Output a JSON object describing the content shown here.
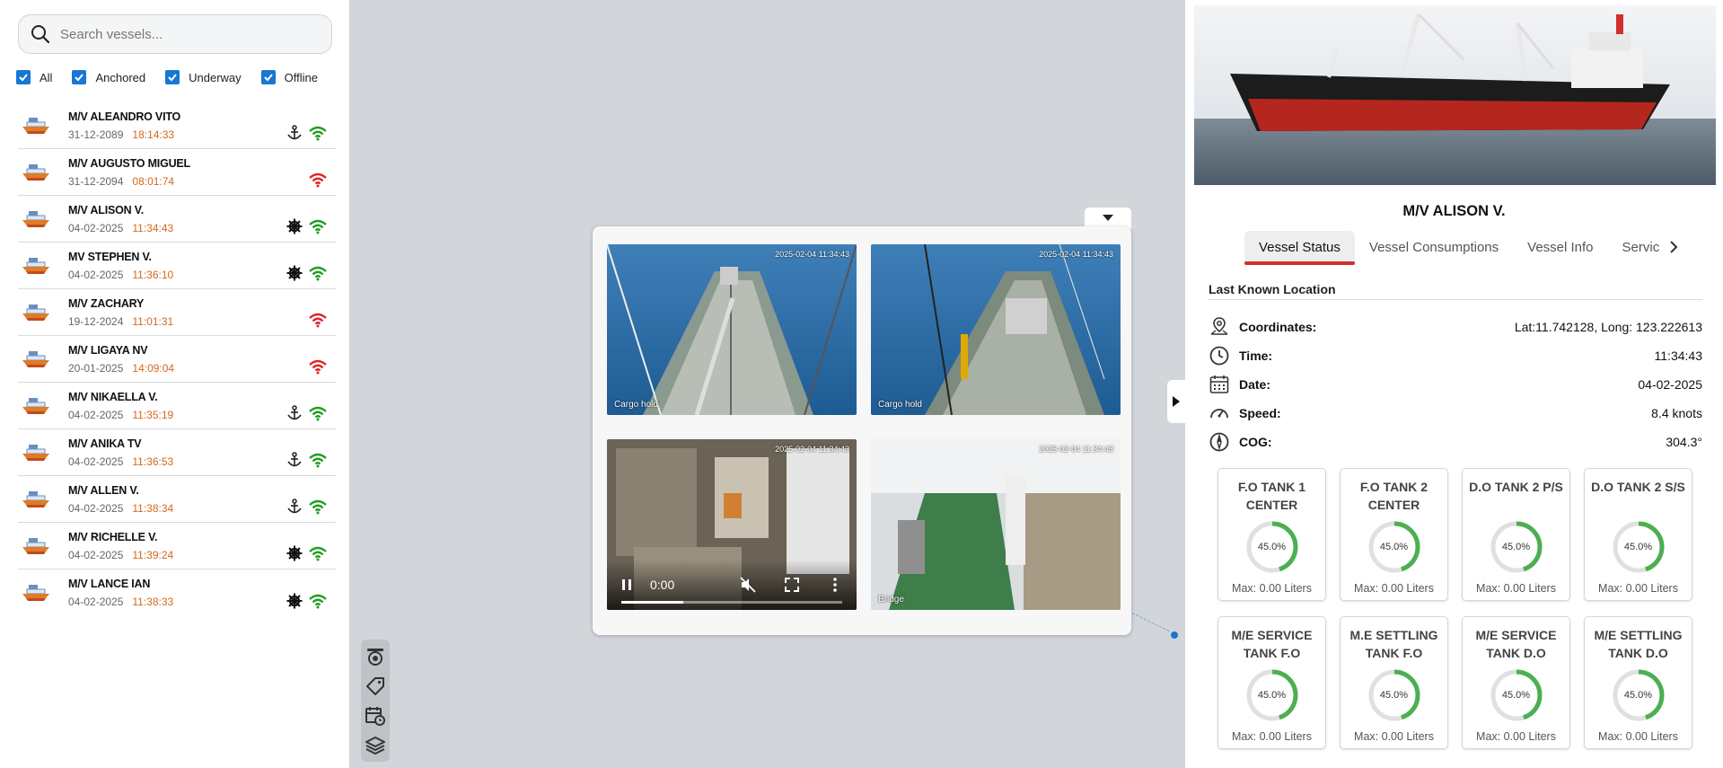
{
  "search": {
    "placeholder": "Search vessels..."
  },
  "filters": [
    {
      "label": "All",
      "checked": true
    },
    {
      "label": "Anchored",
      "checked": true
    },
    {
      "label": "Underway",
      "checked": true
    },
    {
      "label": "Offline",
      "checked": true
    }
  ],
  "vessels": [
    {
      "name": "M/V ALEANDRO VITO",
      "date": "31-12-2089",
      "time": "18:14:33",
      "status": "anchor-icon",
      "signal": "online"
    },
    {
      "name": "M/V AUGUSTO MIGUEL",
      "date": "31-12-2094",
      "time": "08:01:74",
      "status": "",
      "signal": "offline"
    },
    {
      "name": "M/V ALISON V.",
      "date": "04-02-2025",
      "time": "11:34:43",
      "status": "helm-icon",
      "signal": "online"
    },
    {
      "name": "MV STEPHEN V.",
      "date": "04-02-2025",
      "time": "11:36:10",
      "status": "helm-icon",
      "signal": "online"
    },
    {
      "name": "M/V ZACHARY",
      "date": "19-12-2024",
      "time": "11:01:31",
      "status": "",
      "signal": "offline"
    },
    {
      "name": "M/V LIGAYA NV",
      "date": "20-01-2025",
      "time": "14:09:04",
      "status": "",
      "signal": "offline"
    },
    {
      "name": "M/V NIKAELLA V.",
      "date": "04-02-2025",
      "time": "11:35:19",
      "status": "anchor-icon",
      "signal": "online"
    },
    {
      "name": "M/V ANIKA TV",
      "date": "04-02-2025",
      "time": "11:36:53",
      "status": "anchor-icon",
      "signal": "online"
    },
    {
      "name": "M/V ALLEN V.",
      "date": "04-02-2025",
      "time": "11:38:34",
      "status": "anchor-icon",
      "signal": "online"
    },
    {
      "name": "M/V RICHELLE V.",
      "date": "04-02-2025",
      "time": "11:39:24",
      "status": "helm-icon",
      "signal": "online"
    },
    {
      "name": "M/V LANCE IAN",
      "date": "04-02-2025",
      "time": "11:38:33",
      "status": "helm-icon",
      "signal": "online"
    }
  ],
  "cameras": [
    {
      "label": "Cargo hold",
      "timestamp": "2025-02-04 11:34:43"
    },
    {
      "label": "Cargo hold",
      "timestamp": "2025-02-04 11:34:43"
    },
    {
      "label": "",
      "timestamp": "2025-02-04 11:34:43",
      "video": {
        "time": "0:00",
        "progress": 0.28
      }
    },
    {
      "label": "Bridge",
      "timestamp": "2025-02-04 11:34:43"
    }
  ],
  "detail": {
    "vessel_name": "M/V ALISON V.",
    "tabs": [
      "Vessel Status",
      "Vessel Consumptions",
      "Vessel Info",
      "Servic"
    ],
    "active_tab": "Vessel Status",
    "section_title": "Last Known Location",
    "location": {
      "coordinates": {
        "label": "Coordinates:",
        "value": "Lat:11.742128, Long: 123.222613"
      },
      "time": {
        "label": "Time:",
        "value": "11:34:43"
      },
      "date": {
        "label": "Date:",
        "value": "04-02-2025"
      },
      "speed": {
        "label": "Speed:",
        "value": "8.4 knots"
      },
      "cog": {
        "label": "COG:",
        "value": "304.3°"
      }
    },
    "tanks": [
      {
        "name": "F.O TANK 1 CENTER",
        "percent": "45.0%",
        "fill": 0.45,
        "max": "Max: 0.00 Liters"
      },
      {
        "name": "F.O TANK 2 CENTER",
        "percent": "45.0%",
        "fill": 0.45,
        "max": "Max: 0.00 Liters"
      },
      {
        "name": "D.O TANK 2 P/S",
        "percent": "45.0%",
        "fill": 0.45,
        "max": "Max: 0.00 Liters"
      },
      {
        "name": "D.O TANK 2 S/S",
        "percent": "45.0%",
        "fill": 0.45,
        "max": "Max: 0.00 Liters"
      },
      {
        "name": "M/E SERVICE TANK F.O",
        "percent": "45.0%",
        "fill": 0.45,
        "max": "Max: 0.00 Liters"
      },
      {
        "name": "M.E SETTLING TANK F.O",
        "percent": "45.0%",
        "fill": 0.45,
        "max": "Max: 0.00 Liters"
      },
      {
        "name": "M/E SERVICE TANK D.O",
        "percent": "45.0%",
        "fill": 0.45,
        "max": "Max: 0.00 Liters"
      },
      {
        "name": "M/E SETTLING TANK D.O",
        "percent": "45.0%",
        "fill": 0.45,
        "max": "Max: 0.00 Liters"
      }
    ]
  },
  "colors": {
    "accent": "#1976d2",
    "online": "#1e9e1e",
    "offline": "#e02424",
    "time_text": "#d2691e",
    "tab_underline": "#d32f2f",
    "gauge": "#4caf50"
  }
}
